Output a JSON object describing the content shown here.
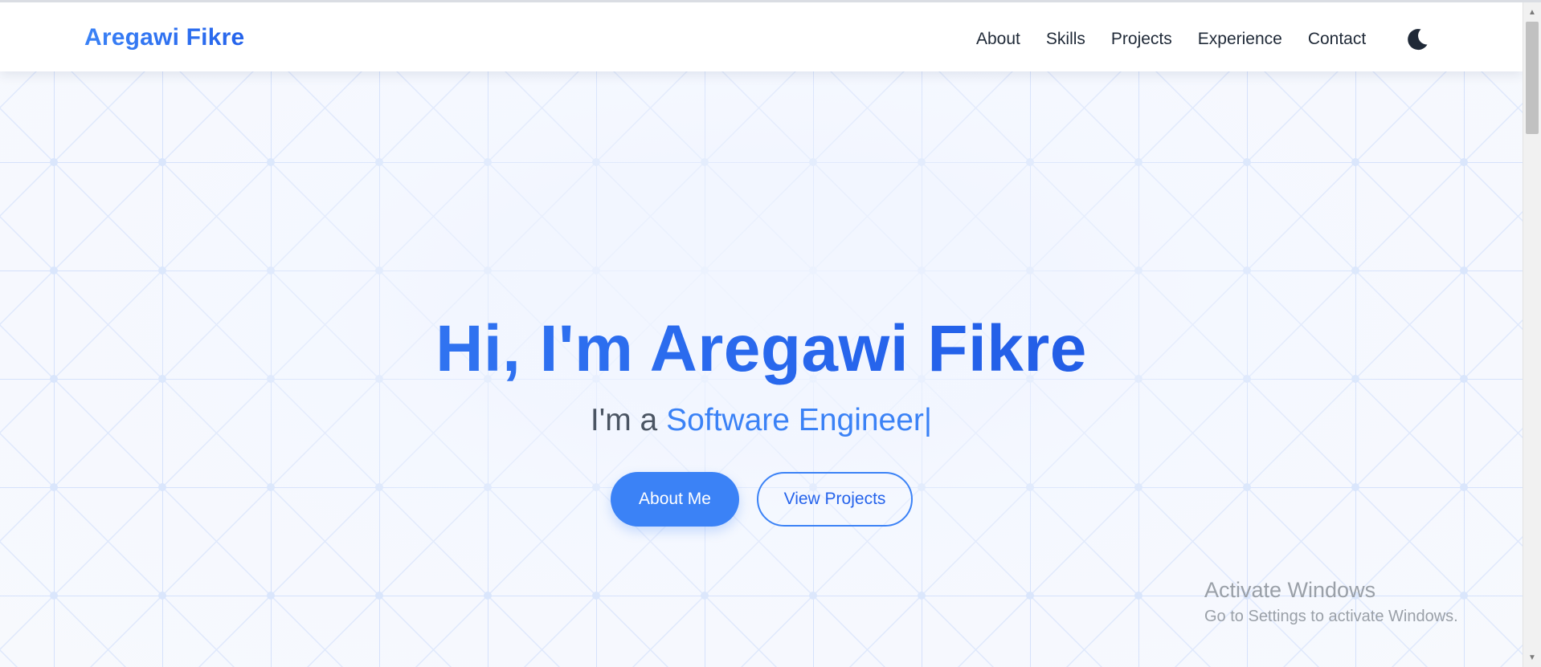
{
  "nav": {
    "brand": "Aregawi Fikre",
    "links": [
      "About",
      "Skills",
      "Projects",
      "Experience",
      "Contact"
    ],
    "theme_toggle_icon": "moon-icon"
  },
  "hero": {
    "title": "Hi, I'm Aregawi Fikre",
    "subtitle_prefix": "I'm a ",
    "subtitle_role": "Software Engineer",
    "cursor": "|",
    "primary_button": "About Me",
    "secondary_button": "View Projects"
  },
  "watermark": {
    "title": "Activate Windows",
    "subtitle": "Go to Settings to activate Windows."
  },
  "colors": {
    "accent": "#3b82f6",
    "accent_dark": "#2563eb",
    "text_dark": "#1f2937",
    "text_muted": "#4b5563"
  }
}
